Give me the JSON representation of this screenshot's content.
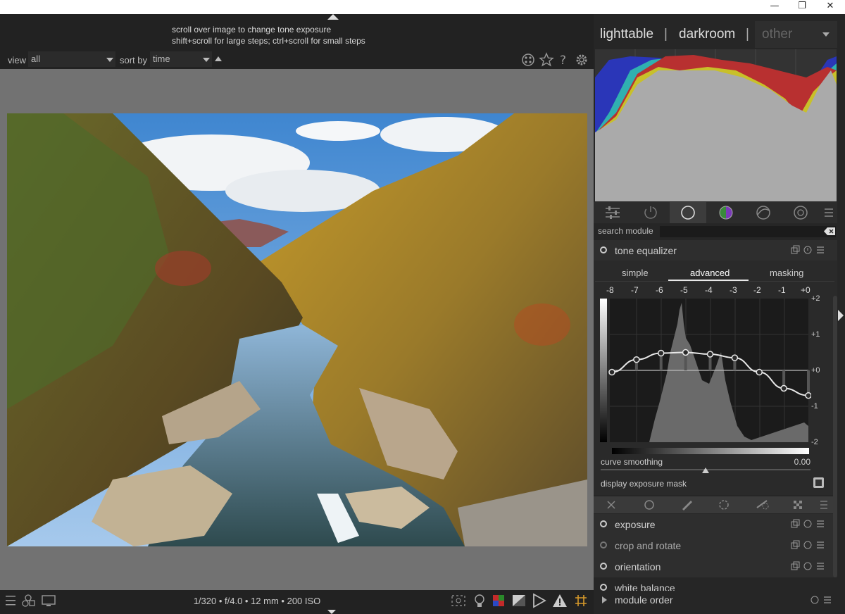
{
  "window": {
    "min_glyph": "—",
    "max_glyph": "❐",
    "close_glyph": "✕"
  },
  "header": {
    "hint_line1": "scroll over image to change tone exposure",
    "hint_line2": "shift+scroll for large steps; ctrl+scroll for small steps"
  },
  "toolbar": {
    "view_label": "view",
    "view_value": "all",
    "sort_label": "sort by",
    "sort_value": "time"
  },
  "views": {
    "lighttable": "lighttable",
    "sep1": "|",
    "darkroom": "darkroom",
    "sep2": "|",
    "other": "other"
  },
  "search": {
    "label": "search module",
    "value": ""
  },
  "tone_equalizer": {
    "title": "tone equalizer",
    "tabs": [
      "simple",
      "advanced",
      "masking"
    ],
    "active_tab": "advanced",
    "ev_labels": [
      "-8",
      "-7",
      "-6",
      "-5",
      "-4",
      "-3",
      "-2",
      "-1",
      "+0"
    ],
    "y_labels": [
      "+2",
      "+1",
      "+0",
      "-1",
      "-2"
    ],
    "curve_ev": [
      -0.05,
      0.3,
      0.48,
      0.5,
      0.45,
      0.35,
      -0.05,
      -0.5,
      -0.7
    ],
    "smoothing_label": "curve smoothing",
    "smoothing_value": "0.00",
    "mask_label": "display exposure mask"
  },
  "modules": [
    {
      "name": "exposure"
    },
    {
      "name": "crop and rotate"
    },
    {
      "name": "orientation"
    },
    {
      "name": "white balance"
    }
  ],
  "module_order": {
    "label": "module order"
  },
  "exif": "1/320 • f/4.0 • 12 mm • 200 ISO",
  "colors": {
    "accent": "#ffffff",
    "panel": "#262626",
    "center_bg": "#727272"
  }
}
